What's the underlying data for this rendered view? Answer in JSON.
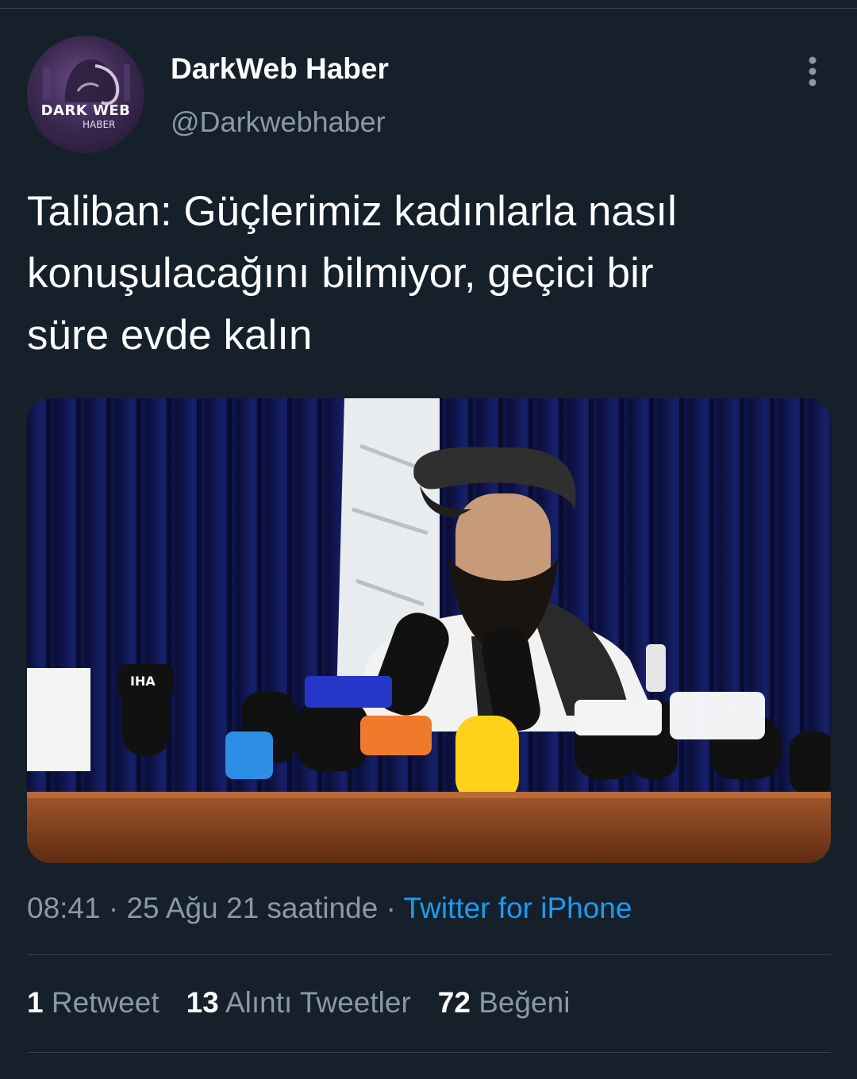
{
  "colors": {
    "background": "#15202b",
    "text_primary": "#ffffff",
    "text_secondary": "#8b98a5",
    "link": "#1d9bf0",
    "divider": "#38444d"
  },
  "author": {
    "display_name": "DarkWeb Haber",
    "handle": "@Darkwebhaber",
    "avatar_logo_line1": "DARK WEB",
    "avatar_logo_line2": "HABER"
  },
  "more_icon": "more-vertical-icon",
  "tweet": {
    "text_lines": [
      "Taliban: Güçlerimiz kadınlarla nasıl",
      "konuşulacağını bilmiyor, geçici bir",
      "süre evde kalın"
    ]
  },
  "media": {
    "mic_flags": [
      "IHA"
    ]
  },
  "meta": {
    "time": "08:41",
    "sep1": " · ",
    "date": "25 Ağu 21 saatinde",
    "sep2": " · ",
    "source": "Twitter for iPhone"
  },
  "stats": [
    {
      "count": "1",
      "label": "Retweet"
    },
    {
      "count": "13",
      "label": "Alıntı Tweetler"
    },
    {
      "count": "72",
      "label": "Beğeni"
    }
  ]
}
